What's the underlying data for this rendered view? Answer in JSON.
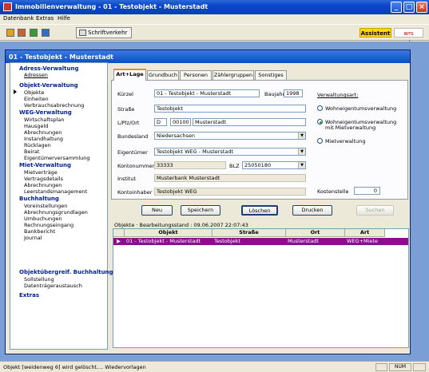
{
  "app": {
    "title": "Immobilienverwaltung - 01 - Testobjekt - Musterstadt"
  },
  "menu": {
    "items": [
      "Datenbank",
      "Extras",
      "Hilfe"
    ]
  },
  "toolbar": {
    "schriftverkehr": "Schriftverkehr",
    "logo_assistent": "Assistent",
    "logo_wrs": "wrs verlag"
  },
  "inner": {
    "title": "01 - Testobjekt - Musterstadt"
  },
  "sidebar": {
    "groups": [
      {
        "header": "Adress-Verwaltung",
        "items": [
          "Adressen"
        ]
      },
      {
        "header": "Objekt-Verwaltung",
        "items": [
          "Objekte",
          "Einheiten",
          "Verbrauchsabrechnung"
        ]
      },
      {
        "header": "WEG-Verwaltung",
        "items": [
          "Wirtschaftsplan",
          "Hausgeld",
          "Abrechnungen",
          "Instandhaltung",
          "Rücklagen",
          "Beirat",
          "Eigentümerversammlung"
        ]
      },
      {
        "header": "Miet-Verwaltung",
        "items": [
          "Mietverträge",
          "Vertragsdetails",
          "Abrechnungen",
          "Leerstandsmanagement"
        ]
      },
      {
        "header": "Buchhaltung",
        "items": [
          "Voreinstellungen",
          "Abrechnungsgrundlagen",
          "Umbuchungen",
          "Rechnungseingang",
          "Bankbericht",
          "Journal"
        ]
      },
      {
        "header": "Objektübergreif. Buchhaltung",
        "items": [
          "Sollstellung",
          "Datenträgeraustausch"
        ]
      },
      {
        "header": "Extras",
        "items": []
      }
    ]
  },
  "tabs": [
    "Art+Lage",
    "Grundbuch",
    "Personen",
    "Zählergruppen",
    "Sonstiges"
  ],
  "form": {
    "kuerzel_label": "Kürzel",
    "kuerzel_value": "01 - Testobjekt - Musterstadt",
    "baujahr_label": "Baujahr",
    "baujahr_value": "1998",
    "strasse_label": "Straße",
    "strasse_value": "Testobjekt",
    "lplzort_label": "L/Plz/Ort",
    "land_value": "D",
    "plz_value": "00100",
    "ort_value": "Musterstadt",
    "bundesland_label": "Bundesland",
    "bundesland_value": "Niedersachsen",
    "eigentuemer_label": "Eigentümer",
    "eigentuemer_value": "Testobjekt WEG - Musterstadt",
    "kontonummer_label": "Kontonummer",
    "kontonummer_value": "33333",
    "blz_label": "BLZ",
    "blz_value": "25050180",
    "institut_label": "Institut",
    "institut_value": "Musterbank Musterstadt",
    "kontoinhaber_label": "Kontoinhaber",
    "kontoinhaber_value": "Testobjekt WEG",
    "verwaltungsart_label": "Verwaltungsart:",
    "radio_weg": "Wohneigentumsverwaltung",
    "radio_wegmiet_1": "Wohneigentumsverwaltung",
    "radio_wegmiet_2": "mit Mietverwaltung",
    "radio_miet": "Mietverwaltung",
    "kostenstelle_label": "Kostenstelle",
    "kostenstelle_value": "0"
  },
  "buttons": {
    "neu": "Neu",
    "speichern": "Speichern",
    "loeschen": "Löschen",
    "drucken": "Drucken",
    "suchen": "Suchen"
  },
  "list": {
    "status": "Objekte · Bearbeitungsstand : 09.06.2007 22:07:43",
    "columns": [
      "Objekt",
      "Straße",
      "Ort",
      "Art"
    ],
    "rows": [
      {
        "objekt": "01 - Testobjekt - Musterstadt",
        "strasse": "Testobjekt",
        "ort": "Musterstadt",
        "art": "WEG+Miete"
      }
    ]
  },
  "statusbar": {
    "message": "Objekt [weidenweg 6] wird gelöscht.... Wiedervorlagen",
    "num": "NUM"
  }
}
